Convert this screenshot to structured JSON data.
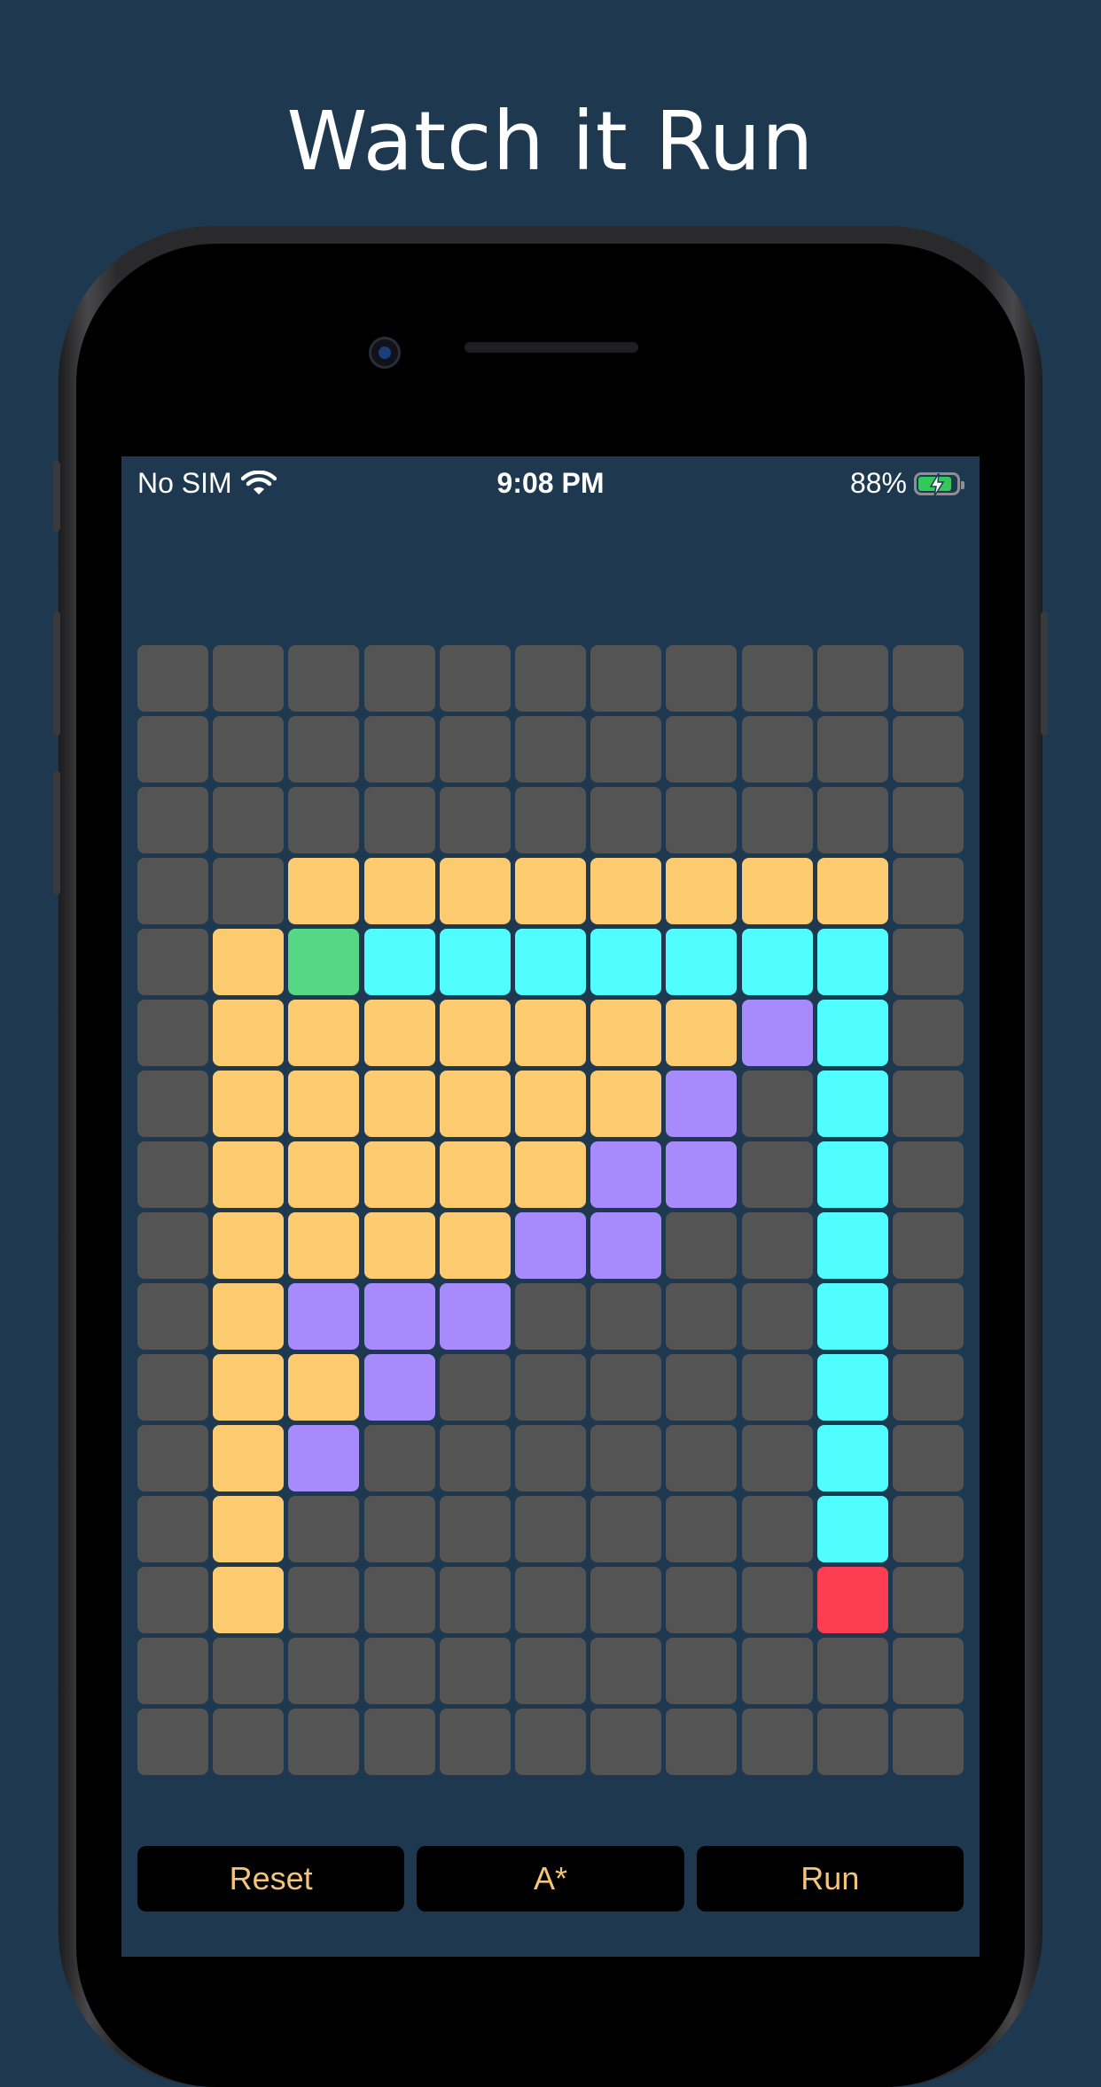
{
  "headline": "Watch it Run",
  "status_bar": {
    "carrier": "No SIM",
    "time": "9:08 PM",
    "battery_percent": "88%",
    "battery_level": 0.88,
    "wifi_icon": "wifi-icon",
    "battery_icon": "battery-charging-icon"
  },
  "grid": {
    "rows": 16,
    "cols": 11,
    "legend": {
      "0": "unvisited",
      "1": "visited",
      "2": "path",
      "3": "frontier",
      "4": "start",
      "5": "end"
    },
    "cells": [
      [
        0,
        0,
        0,
        0,
        0,
        0,
        0,
        0,
        0,
        0,
        0
      ],
      [
        0,
        0,
        0,
        0,
        0,
        0,
        0,
        0,
        0,
        0,
        0
      ],
      [
        0,
        0,
        0,
        0,
        0,
        0,
        0,
        0,
        0,
        0,
        0
      ],
      [
        0,
        0,
        1,
        1,
        1,
        1,
        1,
        1,
        1,
        1,
        0
      ],
      [
        0,
        1,
        4,
        2,
        2,
        2,
        2,
        2,
        2,
        2,
        0
      ],
      [
        0,
        1,
        1,
        1,
        1,
        1,
        1,
        1,
        3,
        2,
        0
      ],
      [
        0,
        1,
        1,
        1,
        1,
        1,
        1,
        3,
        0,
        2,
        0
      ],
      [
        0,
        1,
        1,
        1,
        1,
        1,
        3,
        3,
        0,
        2,
        0
      ],
      [
        0,
        1,
        1,
        1,
        1,
        3,
        3,
        0,
        0,
        2,
        0
      ],
      [
        0,
        1,
        3,
        3,
        3,
        0,
        0,
        0,
        0,
        2,
        0
      ],
      [
        0,
        1,
        1,
        3,
        0,
        0,
        0,
        0,
        0,
        2,
        0
      ],
      [
        0,
        1,
        3,
        0,
        0,
        0,
        0,
        0,
        0,
        2,
        0
      ],
      [
        0,
        1,
        0,
        0,
        0,
        0,
        0,
        0,
        0,
        2,
        0
      ],
      [
        0,
        1,
        0,
        0,
        0,
        0,
        0,
        0,
        0,
        5,
        0
      ],
      [
        0,
        0,
        0,
        0,
        0,
        0,
        0,
        0,
        0,
        0,
        0
      ],
      [
        0,
        0,
        0,
        0,
        0,
        0,
        0,
        0,
        0,
        0,
        0
      ]
    ]
  },
  "controls": {
    "reset_label": "Reset",
    "algorithm_label": "A*",
    "run_label": "Run"
  },
  "colors": {
    "background": "#1e3850",
    "unvisited": "#545454",
    "visited": "#fccb70",
    "path": "#50fcfd",
    "frontier": "#a78afc",
    "start": "#55d785",
    "end": "#fd3e52",
    "button_text": "#f2c57a"
  }
}
